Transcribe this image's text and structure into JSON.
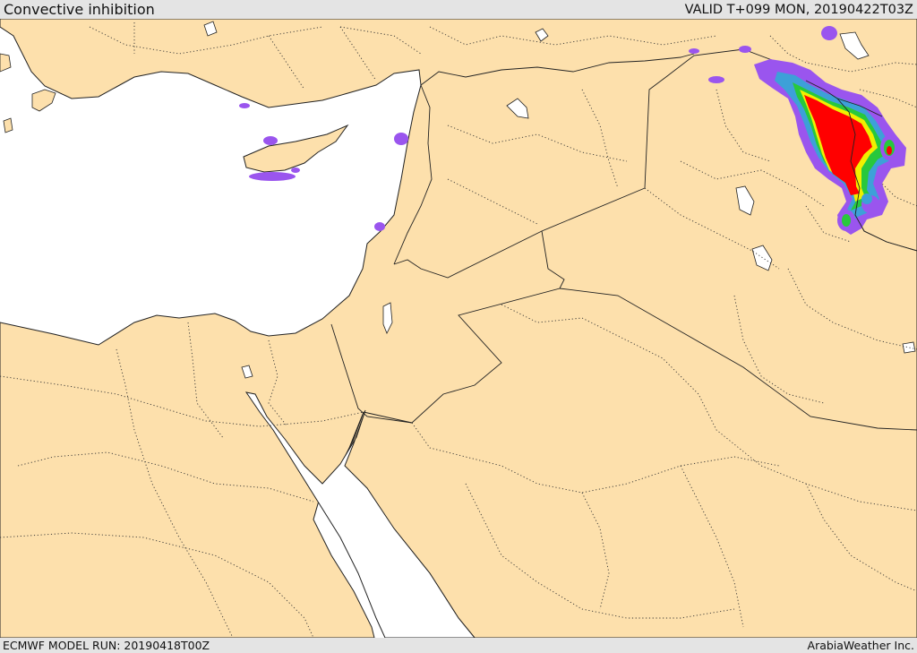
{
  "header": {
    "title": "Convective inhibition",
    "valid": "VALID T+099 MON, 20190422T03Z"
  },
  "footer": {
    "model_run": "ECMWF MODEL RUN: 20190418T00Z",
    "credit": "ArabiaWeather Inc."
  },
  "colors": {
    "land": "#fde0ac",
    "sea": "#ffffff",
    "border": "#222222",
    "cin_outer": "#9a55ee",
    "cin_mid": "#3da0d8",
    "cin_green": "#28c83c",
    "cin_yellow": "#f0f000",
    "cin_core": "#ff0000"
  }
}
